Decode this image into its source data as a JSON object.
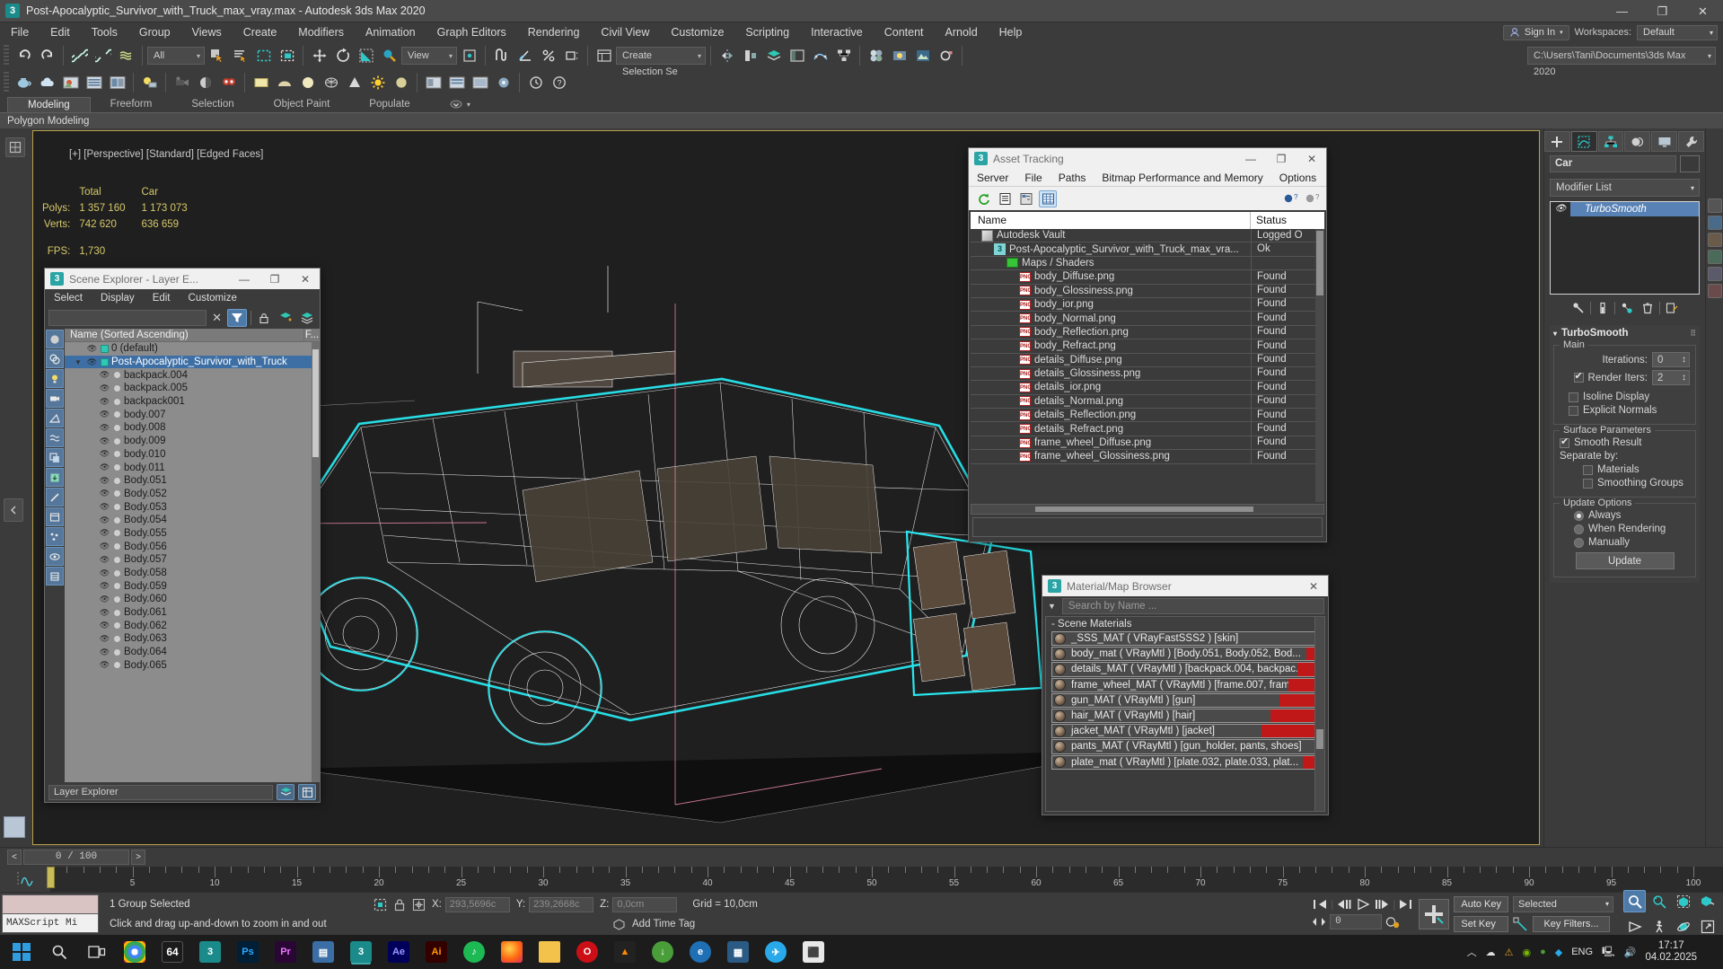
{
  "titlebar": {
    "icon": "3dsmax-icon",
    "title": "Post-Apocalyptic_Survivor_with_Truck_max_vray.max - Autodesk 3ds Max 2020",
    "minimize": "—",
    "maximize": "❐",
    "close": "✕"
  },
  "menubar": {
    "items": [
      "File",
      "Edit",
      "Tools",
      "Group",
      "Views",
      "Create",
      "Modifiers",
      "Animation",
      "Graph Editors",
      "Rendering",
      "Civil View",
      "Customize",
      "Scripting",
      "Interactive",
      "Content",
      "Arnold",
      "Help"
    ],
    "signin": "Sign In",
    "workspaces_label": "Workspaces:",
    "workspace_value": "Default"
  },
  "toolbar": {
    "selection_filter": "All",
    "reference_coord": "View",
    "named_selection_set": "Create Selection Se",
    "project_path": "C:\\Users\\Tani\\Documents\\3ds Max 2020"
  },
  "ribbon": {
    "tabs": [
      "Modeling",
      "Freeform",
      "Selection",
      "Object Paint",
      "Populate"
    ],
    "active_tab": "Modeling",
    "subtab": "Polygon Modeling"
  },
  "viewport": {
    "label": "[+] [Perspective] [Standard] [Edged Faces]",
    "stats": {
      "col_headers": [
        "",
        "Total",
        "Car"
      ],
      "rows": [
        {
          "label": "Polys:",
          "total": "1 357 160",
          "car": "1 173 073"
        },
        {
          "label": "Verts:",
          "total": "742 620",
          "car": "636 659"
        }
      ],
      "fps_label": "FPS:",
      "fps_value": "1,730"
    }
  },
  "scene_explorer": {
    "title": "Scene Explorer - Layer E...",
    "menu": [
      "Select",
      "Display",
      "Edit",
      "Customize"
    ],
    "search_value": "",
    "column_header": "Name (Sorted Ascending)",
    "frozen_column": "F...",
    "footer_label": "Layer Explorer",
    "rows": [
      {
        "name": "0 (default)",
        "indent": 1,
        "type": "layer",
        "selected": false,
        "expander": ""
      },
      {
        "name": "Post-Apocalyptic_Survivor_with_Truck",
        "indent": 1,
        "type": "layer",
        "selected": true,
        "expander": "▼"
      },
      {
        "name": "backpack.004",
        "indent": 2,
        "type": "object",
        "selected": false,
        "expander": ""
      },
      {
        "name": "backpack.005",
        "indent": 2,
        "type": "object",
        "selected": false,
        "expander": ""
      },
      {
        "name": "backpack001",
        "indent": 2,
        "type": "object",
        "selected": false,
        "expander": ""
      },
      {
        "name": "body.007",
        "indent": 2,
        "type": "object",
        "selected": false,
        "expander": ""
      },
      {
        "name": "body.008",
        "indent": 2,
        "type": "object",
        "selected": false,
        "expander": ""
      },
      {
        "name": "body.009",
        "indent": 2,
        "type": "object",
        "selected": false,
        "expander": ""
      },
      {
        "name": "body.010",
        "indent": 2,
        "type": "object",
        "selected": false,
        "expander": ""
      },
      {
        "name": "body.011",
        "indent": 2,
        "type": "object",
        "selected": false,
        "expander": ""
      },
      {
        "name": "Body.051",
        "indent": 2,
        "type": "object",
        "selected": false,
        "expander": ""
      },
      {
        "name": "Body.052",
        "indent": 2,
        "type": "object",
        "selected": false,
        "expander": ""
      },
      {
        "name": "Body.053",
        "indent": 2,
        "type": "object",
        "selected": false,
        "expander": ""
      },
      {
        "name": "Body.054",
        "indent": 2,
        "type": "object",
        "selected": false,
        "expander": ""
      },
      {
        "name": "Body.055",
        "indent": 2,
        "type": "object",
        "selected": false,
        "expander": ""
      },
      {
        "name": "Body.056",
        "indent": 2,
        "type": "object",
        "selected": false,
        "expander": ""
      },
      {
        "name": "Body.057",
        "indent": 2,
        "type": "object",
        "selected": false,
        "expander": ""
      },
      {
        "name": "Body.058",
        "indent": 2,
        "type": "object",
        "selected": false,
        "expander": ""
      },
      {
        "name": "Body.059",
        "indent": 2,
        "type": "object",
        "selected": false,
        "expander": ""
      },
      {
        "name": "Body.060",
        "indent": 2,
        "type": "object",
        "selected": false,
        "expander": ""
      },
      {
        "name": "Body.061",
        "indent": 2,
        "type": "object",
        "selected": false,
        "expander": ""
      },
      {
        "name": "Body.062",
        "indent": 2,
        "type": "object",
        "selected": false,
        "expander": ""
      },
      {
        "name": "Body.063",
        "indent": 2,
        "type": "object",
        "selected": false,
        "expander": ""
      },
      {
        "name": "Body.064",
        "indent": 2,
        "type": "object",
        "selected": false,
        "expander": ""
      },
      {
        "name": "Body.065",
        "indent": 2,
        "type": "object",
        "selected": false,
        "expander": ""
      }
    ]
  },
  "asset_tracking": {
    "title": "Asset Tracking",
    "menu": [
      "Server",
      "File",
      "Paths",
      "Bitmap Performance and Memory",
      "Options"
    ],
    "columns": [
      "Name",
      "Status"
    ],
    "rows": [
      {
        "name": "Autodesk Vault",
        "status": "Logged O",
        "icon": "vault-icon",
        "indent": 1
      },
      {
        "name": "Post-Apocalyptic_Survivor_with_Truck_max_vra...",
        "status": "Ok",
        "icon": "max-file-icon",
        "indent": 2
      },
      {
        "name": "Maps / Shaders",
        "status": "",
        "icon": "maps-icon",
        "indent": 3
      },
      {
        "name": "body_Diffuse.png",
        "status": "Found",
        "icon": "png-icon",
        "indent": 4
      },
      {
        "name": "body_Glossiness.png",
        "status": "Found",
        "icon": "png-icon",
        "indent": 4
      },
      {
        "name": "body_ior.png",
        "status": "Found",
        "icon": "png-icon",
        "indent": 4
      },
      {
        "name": "body_Normal.png",
        "status": "Found",
        "icon": "png-icon",
        "indent": 4
      },
      {
        "name": "body_Reflection.png",
        "status": "Found",
        "icon": "png-icon",
        "indent": 4
      },
      {
        "name": "body_Refract.png",
        "status": "Found",
        "icon": "png-icon",
        "indent": 4
      },
      {
        "name": "details_Diffuse.png",
        "status": "Found",
        "icon": "png-icon",
        "indent": 4
      },
      {
        "name": "details_Glossiness.png",
        "status": "Found",
        "icon": "png-icon",
        "indent": 4
      },
      {
        "name": "details_ior.png",
        "status": "Found",
        "icon": "png-icon",
        "indent": 4
      },
      {
        "name": "details_Normal.png",
        "status": "Found",
        "icon": "png-icon",
        "indent": 4
      },
      {
        "name": "details_Reflection.png",
        "status": "Found",
        "icon": "png-icon",
        "indent": 4
      },
      {
        "name": "details_Refract.png",
        "status": "Found",
        "icon": "png-icon",
        "indent": 4
      },
      {
        "name": "frame_wheel_Diffuse.png",
        "status": "Found",
        "icon": "png-icon",
        "indent": 4
      },
      {
        "name": "frame_wheel_Glossiness.png",
        "status": "Found",
        "icon": "png-icon",
        "indent": 4
      }
    ]
  },
  "material_browser": {
    "title": "Material/Map Browser",
    "search_placeholder": "Search by Name ...",
    "group_label": "- Scene Materials",
    "items": [
      {
        "label": "_SSS_MAT  ( VRayFastSSS2 )  [skin]",
        "red": 0
      },
      {
        "label": "body_mat  ( VRayMtl )  [Body.051, Body.052, Bod...",
        "red": 16
      },
      {
        "label": "details_MAT  ( VRayMtl )  [backpack.004, backpac...",
        "red": 26
      },
      {
        "label": "frame_wheel_MAT  ( VRayMtl )  [frame.007, fram...",
        "red": 36
      },
      {
        "label": "gun_MAT  ( VRayMtl )  [gun]",
        "red": 46
      },
      {
        "label": "hair_MAT  ( VRayMtl )  [hair]",
        "red": 56
      },
      {
        "label": "jacket_MAT  ( VRayMtl )  [jacket]",
        "red": 66
      },
      {
        "label": "pants_MAT  ( VRayMtl )  [gun_holder, pants, shoes]",
        "red": 0
      },
      {
        "label": "plate_mat  ( VRayMtl )  [plate.032, plate.033, plat...",
        "red": 20
      }
    ]
  },
  "command_panel": {
    "object_name": "Car",
    "modifier_list_label": "Modifier List",
    "stack": [
      {
        "name": "TurboSmooth",
        "selected": true
      }
    ],
    "rollout": {
      "title": "TurboSmooth",
      "main_group": "Main",
      "iterations_label": "Iterations:",
      "iterations_value": "0",
      "render_iters_label": "Render Iters:",
      "render_iters_value": "2",
      "render_iters_checked": true,
      "isoline_display": "Isoline Display",
      "isoline_checked": false,
      "explicit_normals": "Explicit Normals",
      "explicit_checked": false,
      "surface_group": "Surface Parameters",
      "smooth_result": "Smooth Result",
      "smooth_checked": true,
      "separate_by": "Separate by:",
      "materials": "Materials",
      "materials_checked": false,
      "smoothing_groups": "Smoothing Groups",
      "smoothing_groups_checked": false,
      "update_group": "Update Options",
      "update_modes": [
        {
          "label": "Always",
          "selected": true
        },
        {
          "label": "When Rendering",
          "selected": false
        },
        {
          "label": "Manually",
          "selected": false
        }
      ],
      "update_button": "Update"
    }
  },
  "timeline": {
    "frame_prev": "<",
    "frame_field": "0 / 100",
    "frame_next": ">",
    "tick_labels": [
      "0",
      "5",
      "10",
      "15",
      "20",
      "25",
      "30",
      "35",
      "40",
      "45",
      "50",
      "55",
      "60",
      "65",
      "70",
      "75",
      "80",
      "85",
      "90",
      "95",
      "100"
    ],
    "playhead_frame": 0,
    "range_start": 0,
    "range_end": 100
  },
  "statusbar": {
    "maxscript_label": "MAXScript Mi",
    "selection_message": "1 Group Selected",
    "hint_message": "Click and drag up-and-down to zoom in and out",
    "coords": {
      "x_label": "X:",
      "x_value": "293,5696c",
      "y_label": "Y:",
      "y_value": "239,2668c",
      "z_label": "Z:",
      "z_value": "0,0cm",
      "grid_label": "Grid = 10,0cm",
      "add_time_tag": "Add Time Tag"
    },
    "animation": {
      "auto_key": "Auto Key",
      "set_key": "Set Key",
      "key_mode": "Selected",
      "key_filters": "Key Filters...",
      "current_frame": "0"
    }
  },
  "taskbar": {
    "items": [
      "start-icon",
      "search-icon",
      "taskview-icon",
      "chrome-icon",
      "64-icon",
      "3dsmax-icon-a",
      "photoshop-icon",
      "premiere-icon",
      "notes-icon",
      "3dsmax-icon-b",
      "aftereffects-icon",
      "illustrator-icon",
      "vlc-icon",
      "firefox-icon",
      "explorer-icon",
      "opera-icon",
      "steam-icon",
      "discord-icon",
      "browser-icon",
      "store-icon",
      "telegram-icon",
      "camera-icon"
    ],
    "lang": "ENG",
    "time": "17:17",
    "date": "04.02.2025"
  }
}
